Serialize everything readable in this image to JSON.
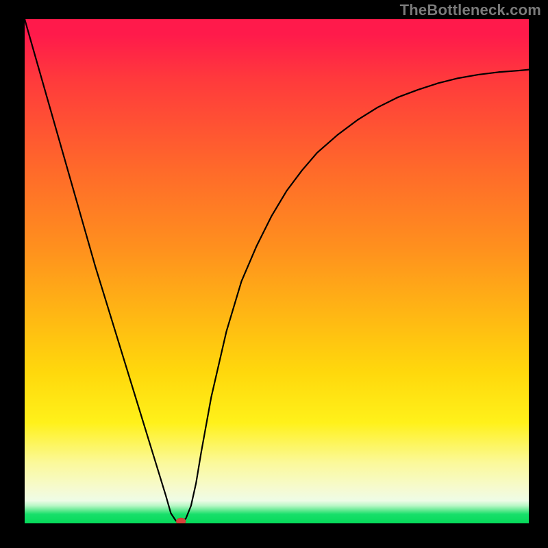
{
  "watermark": "TheBottleneck.com",
  "colors": {
    "frame_background": "#000000",
    "gradient_top": "#ff1a4b",
    "gradient_mid": "#ffd80c",
    "gradient_bottom": "#06da5a",
    "curve_stroke": "#000000",
    "marker_fill": "#d9423a"
  },
  "chart_data": {
    "type": "line",
    "title": "",
    "xlabel": "",
    "ylabel": "",
    "xlim": [
      0,
      100
    ],
    "ylim": [
      0,
      100
    ],
    "grid": false,
    "legend": false,
    "series": [
      {
        "name": "bottleneck-curve",
        "x": [
          0,
          2,
          4,
          6,
          8,
          10,
          12,
          14,
          16,
          18,
          20,
          22,
          24,
          26,
          28,
          29,
          30,
          31,
          32,
          33,
          34,
          35,
          37,
          40,
          43,
          46,
          49,
          52,
          55,
          58,
          62,
          66,
          70,
          74,
          78,
          82,
          86,
          90,
          94,
          98,
          100
        ],
        "y": [
          100,
          93,
          86,
          79,
          72,
          65,
          58,
          51,
          44.5,
          38,
          31.5,
          25,
          18.5,
          12,
          5.5,
          2,
          0.5,
          0,
          1,
          3.5,
          8,
          14,
          25,
          38,
          48,
          55,
          61,
          66,
          70,
          73.5,
          77,
          80,
          82.5,
          84.5,
          86,
          87.3,
          88.3,
          89,
          89.5,
          89.8,
          90
        ]
      }
    ],
    "marker": {
      "x": 31,
      "y": 0
    },
    "annotations": []
  }
}
